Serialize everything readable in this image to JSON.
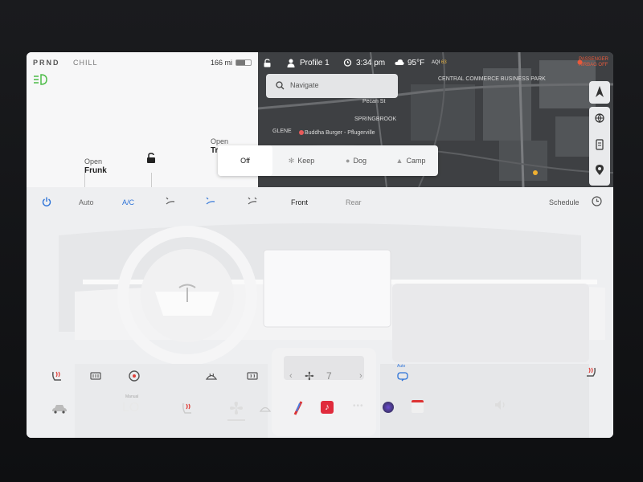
{
  "status": {
    "gear": "PRND",
    "drive_mode": "CHILL",
    "range": "166 mi",
    "profile": "Profile 1",
    "time": "3:34 pm",
    "temperature": "95°F",
    "aqi_label": "AQI",
    "aqi_value": "63",
    "airbag_line1": "PASSENGER",
    "airbag_line2": "AIRBAG OFF"
  },
  "car": {
    "frunk_top": "Open",
    "frunk_bottom": "Frunk",
    "trunk_top": "Open",
    "trunk_bottom": "Tr"
  },
  "map": {
    "search_placeholder": "Navigate",
    "labels": [
      "CENTRAL COMMERCE BUSINESS PARK",
      "Buddha Burger - Pflugerville",
      "SPRINGBROOK",
      "GLENE",
      "Pecan St"
    ]
  },
  "climate_mode": {
    "options": [
      "Off",
      "Keep",
      "Dog",
      "Camp"
    ],
    "selected": "Off"
  },
  "climate": {
    "auto": "Auto",
    "ac": "A/C",
    "front": "Front",
    "rear": "Rear",
    "schedule": "Schedule",
    "fan_speed": "7",
    "fan_auto": "Auto"
  },
  "dock": {
    "temp_mode": "Manual",
    "temp": "LO"
  },
  "colors": {
    "accent": "#2d73d8",
    "warning": "#e85a3c",
    "headlight": "#4cbc47"
  }
}
